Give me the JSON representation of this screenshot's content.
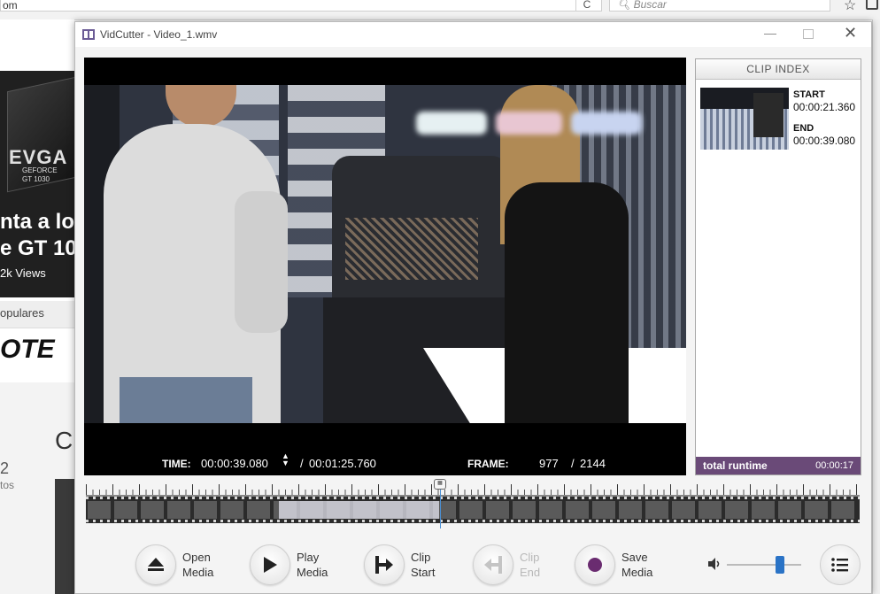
{
  "browser": {
    "url": "om",
    "reload": "C",
    "search_placeholder": "Buscar",
    "star": "☆"
  },
  "background_page": {
    "brand_card": "EVGA",
    "brand_card_sub": "GEFORCE GT 1030",
    "headline_line1": "nta a los",
    "headline_line2": "e GT 103",
    "views": "2k Views",
    "populares": "opulares",
    "brand_logo": "OTE",
    "big_letter": "C",
    "num": "2",
    "tos": "tos"
  },
  "window": {
    "title": "VidCutter - Video_1.wmv",
    "minimize": "—",
    "close": "✕"
  },
  "player": {
    "time_label": "TIME:",
    "time_value": "00:00:39.080",
    "time_separator": "/",
    "time_total": "00:01:25.760",
    "frame_label": "FRAME:",
    "frame_value": "977",
    "frame_separator": "/",
    "frame_total": "2144"
  },
  "clip_index": {
    "header": "CLIP INDEX",
    "clips": [
      {
        "start_label": "START",
        "start": "00:00:21.360",
        "end_label": "END",
        "end": "00:00:39.080"
      }
    ],
    "runtime_label": "total runtime",
    "runtime_value": "00:00:17"
  },
  "timeline": {
    "playhead_fraction": 0.4576,
    "clip_start_fraction": 0.249,
    "clip_end_fraction": 0.4556
  },
  "toolbar": {
    "open": [
      "Open",
      "Media"
    ],
    "play": [
      "Play",
      "Media"
    ],
    "clip_start": [
      "Clip",
      "Start"
    ],
    "clip_end": [
      "Clip",
      "End"
    ],
    "save": [
      "Save",
      "Media"
    ],
    "volume_level": 0.72
  },
  "colors": {
    "runtime_bar": "#6a4a78",
    "save_dot": "#6a2c70",
    "playhead": "#4a8fd4",
    "volume_handle": "#2a73c6"
  },
  "icons": {
    "open": "eject-icon",
    "play": "play-icon",
    "clip_start": "clip-start-icon",
    "clip_end": "clip-end-icon",
    "save": "record-dot-icon",
    "volume": "speaker-icon",
    "menu": "list-menu-icon"
  }
}
